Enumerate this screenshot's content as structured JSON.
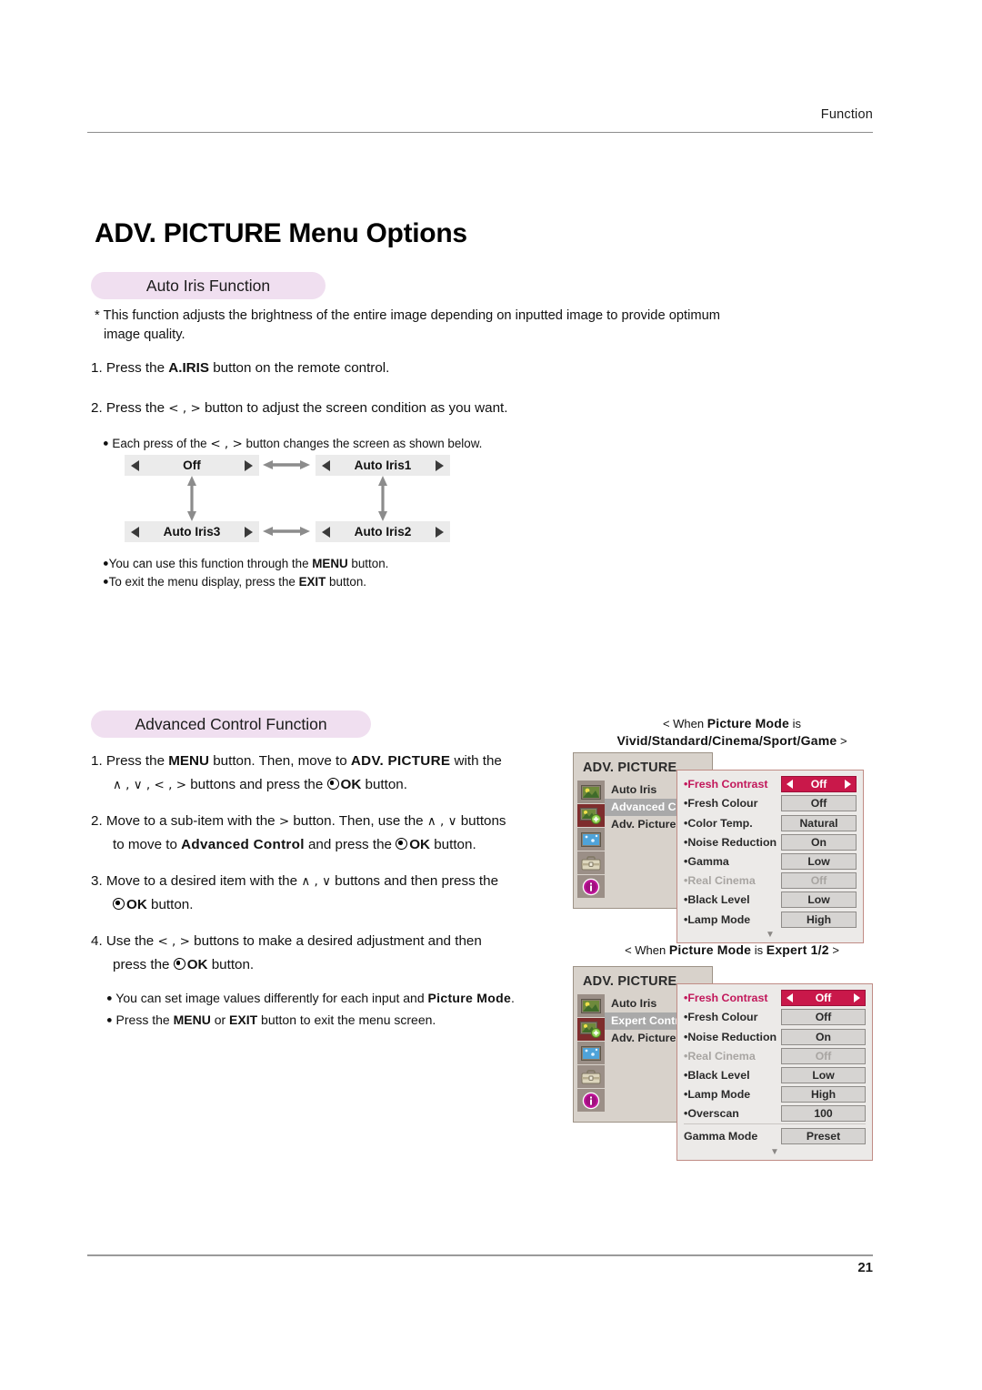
{
  "header": {
    "section_label": "Function"
  },
  "footer": {
    "page_number": "21"
  },
  "title": "ADV. PICTURE Menu Options",
  "sections": {
    "auto_iris": {
      "pill_label": "Auto Iris Function",
      "note_line1": "* This function adjusts the brightness of the entire image depending on inputted image to provide optimum",
      "note_line2": "image quality.",
      "step1_pre": "1. Press the ",
      "step1_bold": "A.IRIS",
      "step1_post": " button on the remote control.",
      "step2_pre": "2. Press the ",
      "step2_keys": "< , >",
      "step2_post": " button to adjust the screen condition as you want.",
      "bullet_each_pre": "Each press of the ",
      "bullet_each_keys": "< , >",
      "bullet_each_post": " button changes the screen as shown below.",
      "flow": {
        "off": "Off",
        "iris1": "Auto Iris1",
        "iris2": "Auto Iris2",
        "iris3": "Auto Iris3"
      },
      "bullet_menu_pre": "You can use this function through the ",
      "bullet_menu_bold": "MENU",
      "bullet_menu_post": " button.",
      "bullet_exit_pre": "To exit the menu display, press the ",
      "bullet_exit_bold": "EXIT",
      "bullet_exit_post": " button."
    },
    "advanced_control": {
      "pill_label": "Advanced Control Function",
      "step1_a": "1. Press the ",
      "step1_b": "MENU",
      "step1_c": " button. Then, move to ",
      "step1_d": "ADV. PICTURE",
      "step1_e": " with the",
      "step1_f": "∧ , ∨ , < , >",
      "step1_g": " buttons and press the ",
      "step1_h": "OK",
      "step1_i": " button.",
      "step2_a": "2. Move to a sub-item with the ",
      "step2_b": ">",
      "step2_c": " button. Then, use the ",
      "step2_d": "∧ , ∨",
      "step2_e": " buttons",
      "step2_f": "to move to ",
      "step2_g": "Advanced Control",
      "step2_h": " and press the ",
      "step2_i": "OK",
      "step2_j": " button.",
      "step3_a": "3. Move to a desired item with the ",
      "step3_b": "∧ , ∨",
      "step3_c": " buttons and then press the",
      "step3_d": "OK",
      "step3_e": " button.",
      "step4_a": "4. Use the ",
      "step4_b": "< , >",
      "step4_c": " buttons to make a desired adjustment and then",
      "step4_d": "press the ",
      "step4_e": "OK",
      "step4_f": " button.",
      "note1_a": "You can set image values differently for each input and ",
      "note1_b": "Picture Mode",
      "note1_c": ".",
      "note2_a": "Press the ",
      "note2_b": "MENU",
      "note2_c": " or ",
      "note2_d": "EXIT",
      "note2_e": " button to exit the menu screen."
    }
  },
  "osd_panels": [
    {
      "caption_pre": "< When ",
      "caption_bold1": "Picture Mode",
      "caption_mid": " is",
      "caption_bold2": "Vivid/Standard/Cinema/Sport/Game",
      "caption_post": " >",
      "menu_title": "ADV. PICTURE",
      "left_items": [
        {
          "label": "Auto Iris",
          "selected": false
        },
        {
          "label": "Advanced Cont",
          "selected": true
        },
        {
          "label": "Adv. Picture Reś",
          "selected": false
        }
      ],
      "icons": [
        {
          "name": "picture-icon",
          "selected": false
        },
        {
          "name": "adv-picture-icon",
          "selected": true
        },
        {
          "name": "screen-icon",
          "selected": false
        },
        {
          "name": "option-toolbox-icon",
          "selected": false
        },
        {
          "name": "information-icon",
          "selected": false
        }
      ],
      "rows": [
        {
          "name": "•Fresh Contrast",
          "value": "Off",
          "selected": true,
          "dim": false
        },
        {
          "name": "•Fresh Colour",
          "value": "Off",
          "selected": false,
          "dim": false
        },
        {
          "name": "•Color Temp.",
          "value": "Natural",
          "selected": false,
          "dim": false
        },
        {
          "name": "•Noise Reduction",
          "value": "On",
          "selected": false,
          "dim": false
        },
        {
          "name": "•Gamma",
          "value": "Low",
          "selected": false,
          "dim": false
        },
        {
          "name": "•Real Cinema",
          "value": "Off",
          "selected": false,
          "dim": true
        },
        {
          "name": "•Black Level",
          "value": "Low",
          "selected": false,
          "dim": false
        },
        {
          "name": "•Lamp Mode",
          "value": "High",
          "selected": false,
          "dim": false
        }
      ],
      "scroll_glyph": "▼"
    },
    {
      "caption_pre": "< When ",
      "caption_bold1": "Picture Mode",
      "caption_mid": " is ",
      "caption_bold2": "Expert 1/2",
      "caption_post": " >",
      "menu_title": "ADV. PICTURE",
      "left_items": [
        {
          "label": "Auto Iris",
          "selected": false
        },
        {
          "label": "Expert Control",
          "selected": true
        },
        {
          "label": "Adv. Picture Reś",
          "selected": false
        }
      ],
      "icons": [
        {
          "name": "picture-icon",
          "selected": false
        },
        {
          "name": "adv-picture-icon",
          "selected": true
        },
        {
          "name": "screen-icon",
          "selected": false
        },
        {
          "name": "option-toolbox-icon",
          "selected": false
        },
        {
          "name": "information-icon",
          "selected": false
        }
      ],
      "rows": [
        {
          "name": "•Fresh Contrast",
          "value": "Off",
          "selected": true,
          "dim": false
        },
        {
          "name": "•Fresh Colour",
          "value": "Off",
          "selected": false,
          "dim": false
        },
        {
          "name": "•Noise Reduction",
          "value": "On",
          "selected": false,
          "dim": false
        },
        {
          "name": "•Real Cinema",
          "value": "Off",
          "selected": false,
          "dim": true
        },
        {
          "name": "•Black Level",
          "value": "Low",
          "selected": false,
          "dim": false
        },
        {
          "name": "•Lamp Mode",
          "value": "High",
          "selected": false,
          "dim": false
        },
        {
          "name": "•Overscan",
          "value": "100",
          "selected": false,
          "dim": false
        },
        {
          "name": "Gamma Mode",
          "value": "Preset",
          "selected": false,
          "dim": false,
          "separator": true
        }
      ],
      "scroll_glyph": "▼"
    }
  ],
  "colors": {
    "pill_pink": "#f0dff0",
    "osd_highlight": "#c9184a",
    "osd_label_highlight": "#c2185b",
    "osd_panel_bg": "#eceae8",
    "osd_left_bg": "#d8d2cb",
    "osd_icon_selected": "#7e2d2d",
    "osd_border": "#c08c85"
  }
}
